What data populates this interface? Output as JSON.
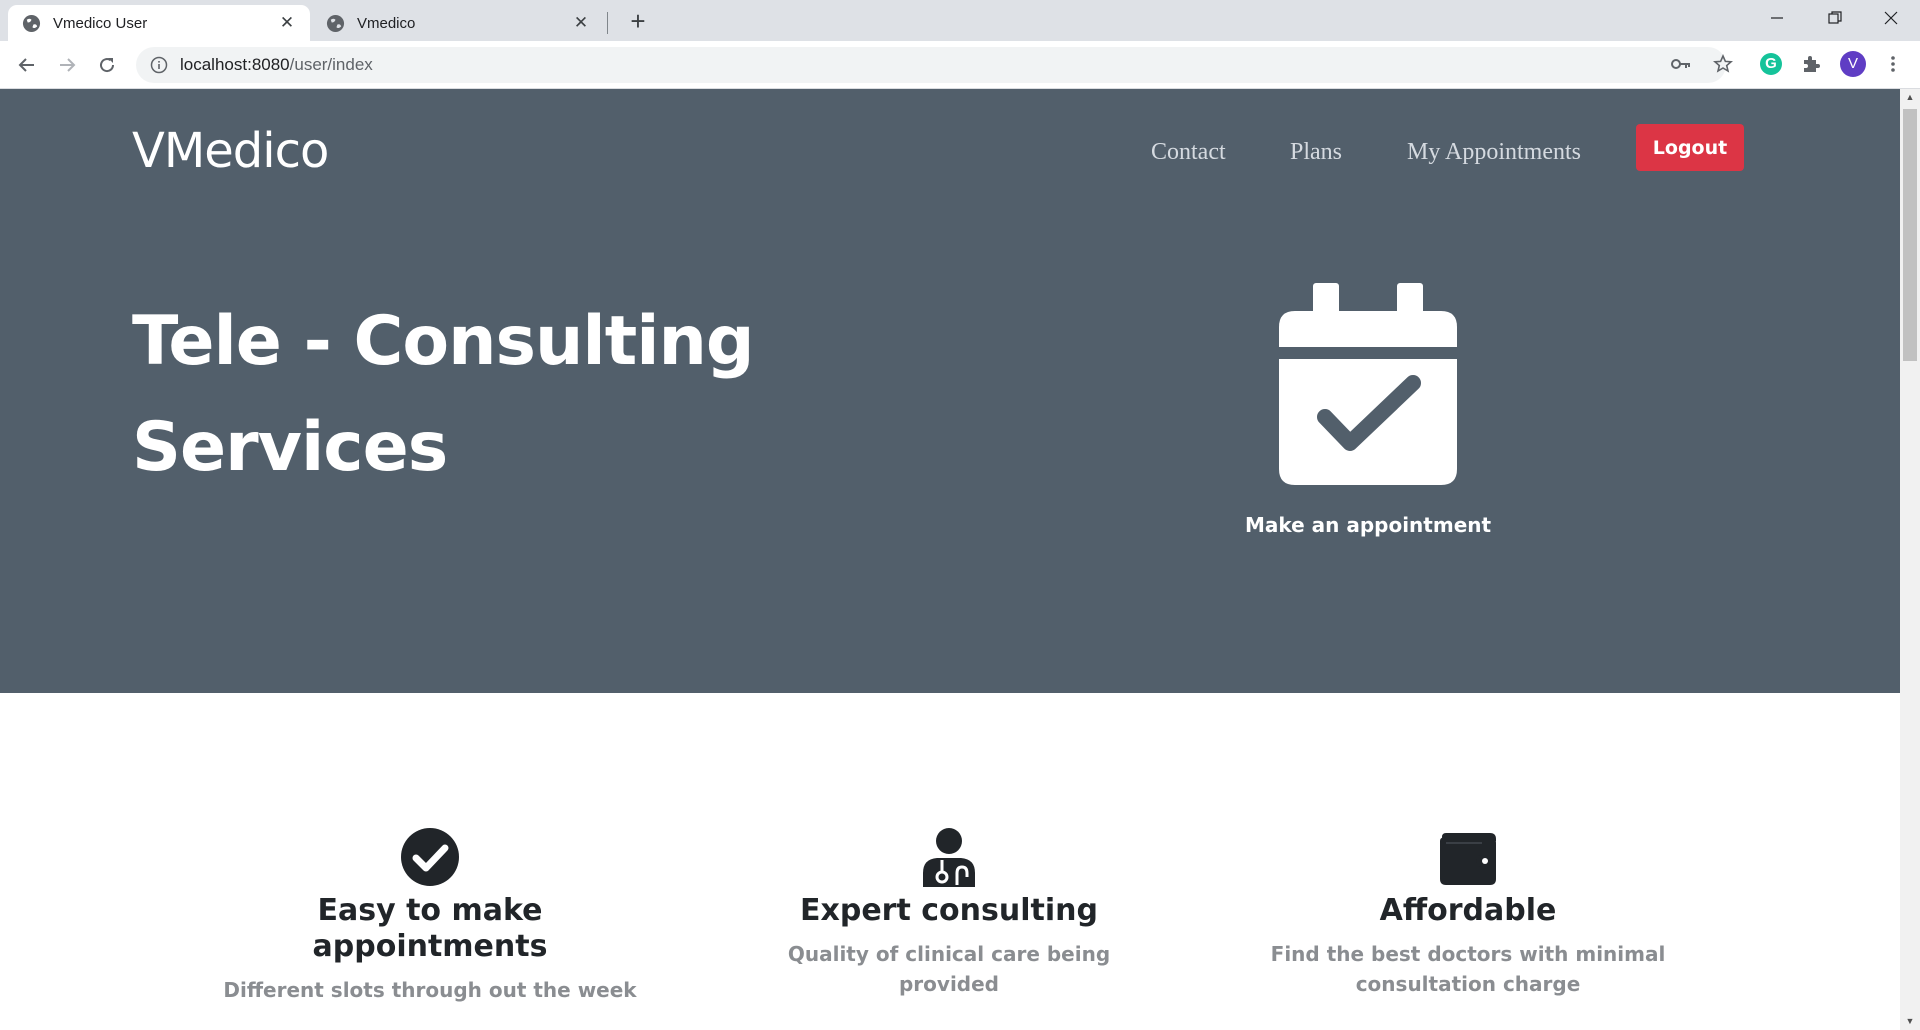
{
  "browser": {
    "tabs": [
      {
        "title": "Vmedico User",
        "active": true
      },
      {
        "title": "Vmedico",
        "active": false
      }
    ],
    "url_host": "localhost:8080",
    "url_path": "/user/index",
    "profile_initial": "V",
    "grammarly_letter": "G"
  },
  "header": {
    "brand": "VMedico",
    "nav": [
      "Contact",
      "Plans",
      "My Appointments"
    ],
    "logout_label": "Logout"
  },
  "hero": {
    "title_line1": "Tele - Consulting",
    "title_line2": "Services",
    "appointment_label": "Make an appointment"
  },
  "features": [
    {
      "icon": "check-circle-icon",
      "title": "Easy to make appointments",
      "text": "Different slots through out the week"
    },
    {
      "icon": "doctor-icon",
      "title": "Expert consulting",
      "text": "Quality of clinical care being provided"
    },
    {
      "icon": "wallet-icon",
      "title": "Affordable",
      "text": "Find the best doctors with minimal consultation charge"
    }
  ],
  "colors": {
    "hero_bg": "#525f6b",
    "logout_bg": "#dc3545",
    "feature_muted": "#8a8d91"
  }
}
